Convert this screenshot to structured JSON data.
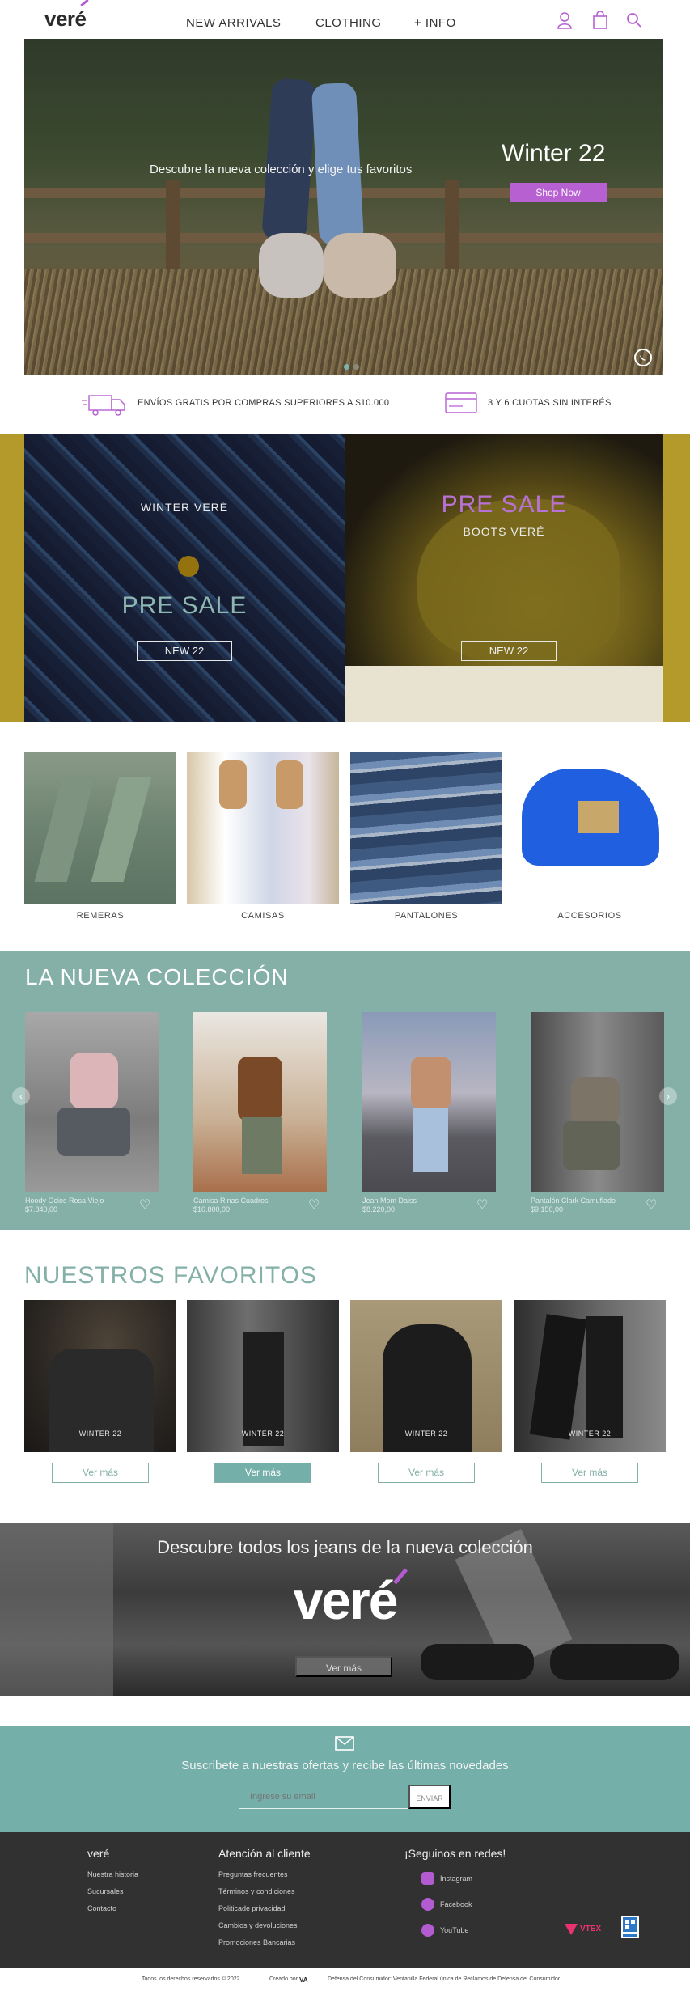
{
  "header": {
    "logo": "veré",
    "nav": [
      "NEW ARRIVALS",
      "CLOTHING",
      "+ INFO"
    ],
    "icons": [
      "user-icon",
      "bag-icon",
      "search-icon"
    ]
  },
  "hero": {
    "tagline": "Descubre la nueva colección y elige tus favoritos",
    "title": "Winter 22",
    "button": "Shop Now"
  },
  "benefits": {
    "shipping": "ENVÍOS GRATIS POR COMPRAS SUPERIORES A $10.000",
    "installments": "3 Y 6 CUOTAS SIN INTERÉS"
  },
  "presale": [
    {
      "small": "WINTER VERÉ",
      "big": "PRE SALE",
      "button": "NEW 22"
    },
    {
      "big": "PRE SALE",
      "small": "BOOTS VERÉ",
      "button": "NEW 22"
    }
  ],
  "categories": [
    "REMERAS",
    "CAMISAS",
    "PANTALONES",
    "ACCESORIOS"
  ],
  "collection": {
    "title": "LA NUEVA COLECCIÓN",
    "products": [
      {
        "name": "Hoody Ocios Rosa Viejo",
        "price": "$7.840,00"
      },
      {
        "name": "Camisa Rinas Cuadros",
        "price": "$10.800,00"
      },
      {
        "name": "Jean Mom Daiss",
        "price": "$8.220,00"
      },
      {
        "name": "Pantalón Clark Camuflado",
        "price": "$9.150,00"
      }
    ]
  },
  "favorites": {
    "title": "NUESTROS FAVORITOS",
    "tag": "WINTER 22",
    "button": "Ver más"
  },
  "jeans_banner": {
    "title": "Descubre todos los jeans de la nueva colección",
    "logo": "veré",
    "button": "Ver más"
  },
  "newsletter": {
    "text": "Suscribete a nuestras ofertas y recibe las últimas novedades",
    "placeholder": "Ingrese su email",
    "button": "ENVIAR"
  },
  "footer": {
    "brand": "veré",
    "brand_links": [
      "Nuestra historia",
      "Sucursales",
      "Contacto"
    ],
    "support_title": "Atención al cliente",
    "support_links": [
      "Preguntas frecuentes",
      "Términos y condiciones",
      "Politicade privacidad",
      "Cambios y devoluciones",
      "Promociones Bancarias"
    ],
    "social_title": "¡Seguinos en redes!",
    "social": [
      "Instagram",
      "Facebook",
      "YouTube"
    ],
    "vtex": "VTEX",
    "rights": "Todos los derechos reservados © 2022",
    "created": "Creado por",
    "creator": "VA",
    "consumer": "Defensa del Consumidor: Ventanilla Federal única de Reclamos de Defensa del Consumidor."
  },
  "colors": {
    "accent": "#b660d2",
    "teal": "#85b0a8",
    "mustard": "#b49a2a",
    "footer": "#313131"
  }
}
